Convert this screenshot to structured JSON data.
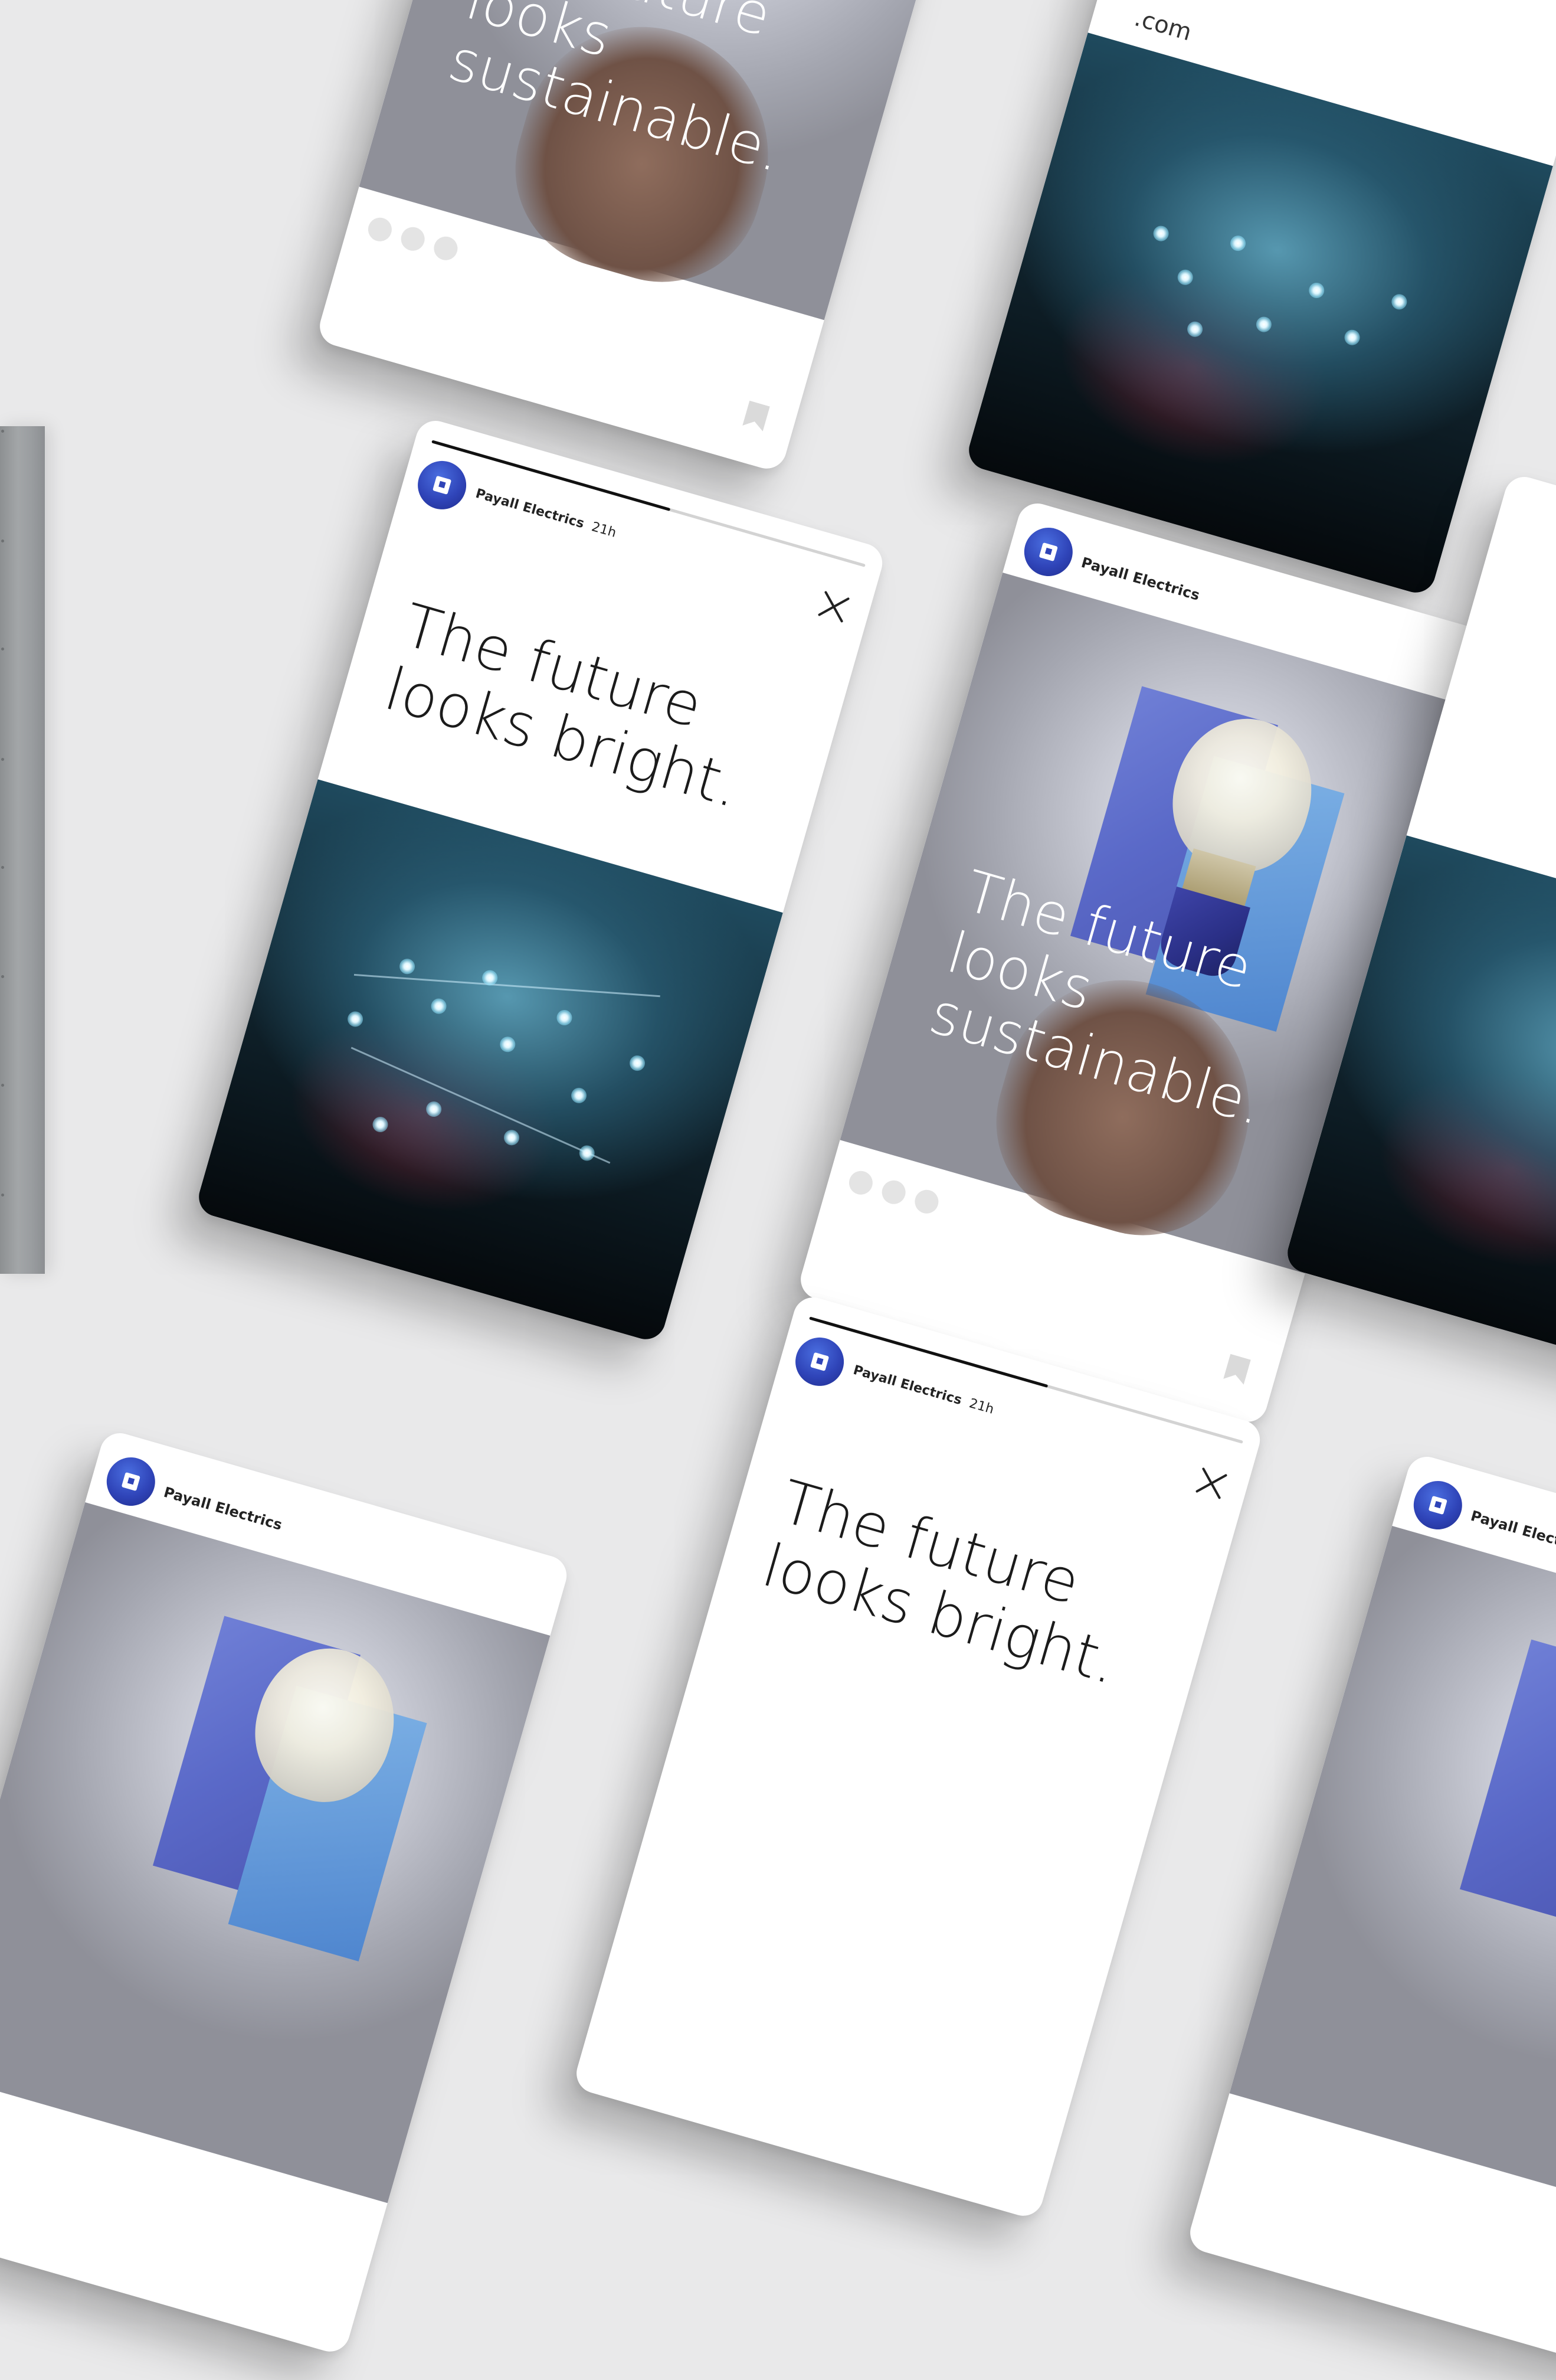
{
  "brand": {
    "name": "Payall Electrics",
    "time": "21h",
    "url": "PayallElectrics.com",
    "accent": "#2f44b8"
  },
  "story_card": {
    "line1": "The future",
    "line2": "looks bright.",
    "progress": 0.55
  },
  "feed_card": {
    "line1": "The future",
    "line2": "looks sustainable."
  },
  "partial_top_right": {
    "url_fragment": ".com"
  },
  "icons": [
    "close-icon",
    "bookmark-icon",
    "avatar-logo-icon",
    "carousel-dots"
  ]
}
